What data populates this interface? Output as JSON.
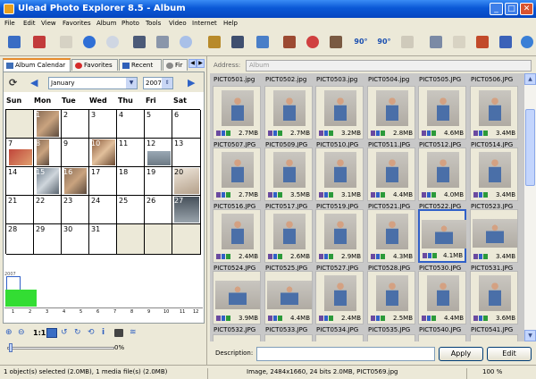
{
  "window": {
    "title": "Ulead Photo Explorer 8.5 - Album"
  },
  "menu": [
    "File",
    "Edit",
    "View",
    "Favorites",
    "Album",
    "Photo",
    "Tools",
    "Video",
    "Internet",
    "Help"
  ],
  "toolbar": {
    "rotate_left_label": "90°",
    "rotate_right_label": "90°"
  },
  "tabs": [
    {
      "label": "Album Calendar",
      "icon": "calendar-icon"
    },
    {
      "label": "Favorites",
      "icon": "heart-icon"
    },
    {
      "label": "Recent",
      "icon": "recent-icon"
    },
    {
      "label": "Fir",
      "icon": "find-icon"
    }
  ],
  "calendar": {
    "month": "January",
    "year": "2007",
    "weekdays": [
      "Sun",
      "Mon",
      "Tue",
      "Wed",
      "Thu",
      "Fri",
      "Sat"
    ],
    "days": [
      "1",
      "2",
      "3",
      "4",
      "5",
      "6",
      "7",
      "8",
      "9",
      "10",
      "11",
      "12",
      "13",
      "14",
      "15",
      "16",
      "17",
      "18",
      "19",
      "20",
      "21",
      "22",
      "23",
      "24",
      "25",
      "26",
      "27",
      "28",
      "29",
      "30",
      "31"
    ]
  },
  "timeline": {
    "year_label": "2007",
    "months": [
      "1",
      "2",
      "3",
      "4",
      "5",
      "6",
      "7",
      "8",
      "9",
      "10",
      "11",
      "12"
    ]
  },
  "zoom": {
    "one_to_one": "1:1",
    "progress": "0%"
  },
  "address": {
    "label": "Address:",
    "value": "Album"
  },
  "row0_files": [
    "PICT0501.jpg",
    "PICT0502.jpg",
    "PICT0503.jpg",
    "PICT0504.jpg",
    "PICT0505.JPG",
    "PICT0506.JPG"
  ],
  "thumbnails": [
    [
      {
        "file": "PICT0507.JPG",
        "size": "2.7MB"
      },
      {
        "file": "PICT0509.JPG",
        "size": "2.7MB"
      },
      {
        "file": "PICT0510.JPG",
        "size": "3.2MB"
      },
      {
        "file": "PICT0511.JPG",
        "size": "2.8MB"
      },
      {
        "file": "PICT0512.JPG",
        "size": "4.6MB"
      },
      {
        "file": "PICT0514.JPG",
        "size": "3.4MB"
      }
    ],
    [
      {
        "file": "PICT0516.JPG",
        "size": "2.7MB"
      },
      {
        "file": "PICT0517.JPG",
        "size": "3.5MB"
      },
      {
        "file": "PICT0519.JPG",
        "size": "3.1MB"
      },
      {
        "file": "PICT0521.JPG",
        "size": "4.4MB"
      },
      {
        "file": "PICT0522.JPG",
        "size": "4.0MB"
      },
      {
        "file": "PICT0523.JPG",
        "size": "3.4MB"
      }
    ],
    [
      {
        "file": "PICT0524.JPG",
        "size": "2.4MB"
      },
      {
        "file": "PICT0525.JPG",
        "size": "2.6MB"
      },
      {
        "file": "PICT0527.JPG",
        "size": "2.9MB"
      },
      {
        "file": "PICT0528.JPG",
        "size": "4.3MB"
      },
      {
        "file": "PICT0530.JPG",
        "size": "4.1MB"
      },
      {
        "file": "PICT0531.JPG",
        "size": "3.4MB"
      }
    ],
    [
      {
        "file": "PICT0532.JPG",
        "size": "3.9MB"
      },
      {
        "file": "PICT0533.JPG",
        "size": "4.4MB"
      },
      {
        "file": "PICT0534.JPG",
        "size": "2.4MB"
      },
      {
        "file": "PICT0535.JPG",
        "size": "2.5MB"
      },
      {
        "file": "PICT0540.JPG",
        "size": "4.4MB"
      },
      {
        "file": "PICT0541.JPG",
        "size": "3.6MB"
      }
    ]
  ],
  "description": {
    "label": "Description:",
    "value": ""
  },
  "buttons": {
    "apply": "Apply",
    "edit": "Edit"
  },
  "status": {
    "selection": "1 object(s) selected (2.0MB), 1 media file(s) (2.0MB)",
    "image_info": "Image, 2484x1660, 24 bits 2.0MB, PICT0569.jpg",
    "zoom": "100 %"
  },
  "colors": {
    "title_blue": "#0a58d6",
    "calendar_bar_green": "#33dd33"
  }
}
